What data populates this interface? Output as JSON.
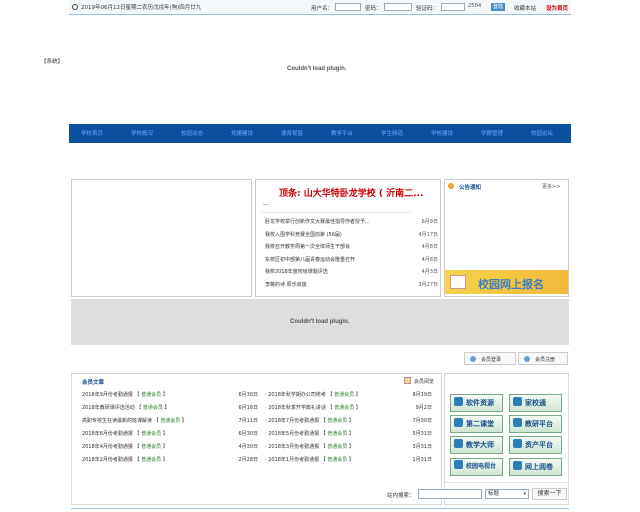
{
  "topbar": {
    "date": "2019年06月12日星期二农历戊戌年(狗)四月廿九",
    "username_label": "用户名：",
    "password_label": "密码：",
    "captcha_label": "验证码：",
    "captcha_code": "2504",
    "login_label": "登陆",
    "favorite_label": "收藏本站",
    "homepage_label": "设为首页"
  },
  "header": {
    "top_link": "【系统】",
    "plugin_msg": "Couldn't load plugin."
  },
  "nav": {
    "items": [
      "学校首页",
      "学校概况",
      "校园动态",
      "党建建设",
      "德育视窗",
      "教学平台",
      "学生频道",
      "学校建设",
      "学籍管理",
      "校园论坛"
    ]
  },
  "news": {
    "headline": "顶条: 山大华特卧龙学校 ( 沂南二...",
    "items": [
      {
        "title": "卧龙学校举行创新作文大赛最佳指导作者授予...",
        "date": "6月9日"
      },
      {
        "title": "我校入围学科竞赛全国前茅 (56届)",
        "date": "4月17日"
      },
      {
        "title": "我校召开教学周第一次全体师生干部会",
        "date": "4月8日"
      },
      {
        "title": "东校区初中部第八届青春运动会隆重召开",
        "date": "4月8日"
      },
      {
        "title": "我校2018年度校级课题评选",
        "date": "4月3日"
      },
      {
        "title": "李薇的诗 原乐启旋",
        "date": "3月27日"
      }
    ]
  },
  "notice": {
    "title": "公告通知",
    "more": "更多>>",
    "banner": "校园网上报名"
  },
  "middle": {
    "plugin_msg": "Couldn't load plugin."
  },
  "auth": {
    "login": "会员登录",
    "register": "会员注册"
  },
  "articles": {
    "title": "会员文章",
    "more": "会员阅览",
    "left": [
      {
        "title": "2018年9月份考勤通报",
        "tag": "普通会员",
        "date": "6月30日"
      },
      {
        "title": "2018年教研课评选活动",
        "tag": "普通会员",
        "date": "6月16日"
      },
      {
        "title": "高职专校生在读最新的班课解读",
        "tag": "普通会员",
        "date": "7月11日"
      },
      {
        "title": "2018年6月份考勤通报",
        "tag": "普通会员",
        "date": "6月30日"
      },
      {
        "title": "2018年4月份考勤通报",
        "tag": "普通会员",
        "date": "4月30日"
      },
      {
        "title": "2018年2月份考勤通报",
        "tag": "普通会员",
        "date": "2月28日"
      }
    ],
    "right": [
      {
        "title": "2018年秋学期办公司统考",
        "tag": "普通会员",
        "date": "8月19日"
      },
      {
        "title": "2018年秋季开学典礼讲话",
        "tag": "普通会员",
        "date": "9月2日"
      },
      {
        "title": "2018年7月份考勤通报",
        "tag": "普通会员",
        "date": "7月30日"
      },
      {
        "title": "2018年5月份考勤通报",
        "tag": "普通会员",
        "date": "5月31日"
      },
      {
        "title": "2018年3月份考勤通报",
        "tag": "普通会员",
        "date": "3月31日"
      },
      {
        "title": "2018年1月份考勤通报",
        "tag": "普通会员",
        "date": "1月31日"
      }
    ]
  },
  "quicklinks": [
    {
      "label": "软件资源",
      "icon": "software-icon"
    },
    {
      "label": "家校通",
      "icon": "home-school-icon"
    },
    {
      "label": "第二课堂",
      "icon": "classroom-icon"
    },
    {
      "label": "教研平台",
      "icon": "research-icon"
    },
    {
      "label": "教学大师",
      "icon": "teacher-icon"
    },
    {
      "label": "资产平台",
      "icon": "asset-icon"
    },
    {
      "label": "校园电视台",
      "icon": "tv-icon"
    },
    {
      "label": "网上阅卷",
      "icon": "exam-icon"
    }
  ],
  "search": {
    "label": "站内搜索：",
    "select_value": "标题",
    "button": "搜索一下"
  }
}
